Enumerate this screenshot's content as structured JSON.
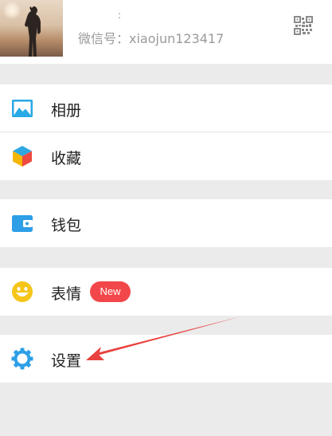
{
  "profile": {
    "name": ":",
    "wechat_id": "微信号：xiaojun123417",
    "avatar": "sunset-silhouette-photo",
    "qr_icon": "qr-code-icon"
  },
  "menu": {
    "album": {
      "label": "相册",
      "icon": "photo-album-icon",
      "color": "#29a9e6"
    },
    "favorites": {
      "label": "收藏",
      "icon": "cube-favorites-icon"
    },
    "wallet": {
      "label": "钱包",
      "icon": "wallet-icon",
      "color": "#2d9fe6"
    },
    "stickers": {
      "label": "表情",
      "icon": "smiley-icon",
      "badge": "New",
      "color": "#f5c518"
    },
    "settings": {
      "label": "设置",
      "icon": "gear-icon",
      "color": "#2d9fe6"
    }
  },
  "colors": {
    "background": "#ebebeb",
    "badge": "#f2474a",
    "annotation_arrow": "#e8413f"
  }
}
